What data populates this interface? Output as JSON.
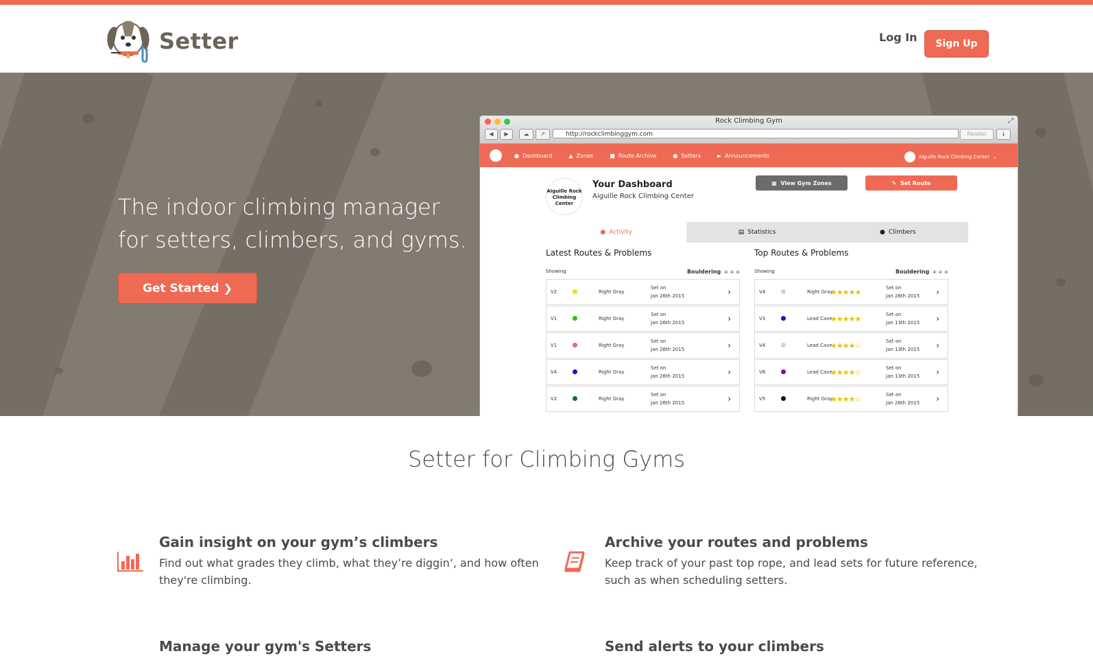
{
  "colors": {
    "accent": "#ef6a55",
    "text": "#4a4a4a",
    "hero_bg": "#817b71"
  },
  "header": {
    "brand": "Setter",
    "login_label": "Log In",
    "signup_label": "Sign Up"
  },
  "hero": {
    "title": "The indoor climbing manager for setters, climbers, and gyms.",
    "cta_label": "Get Started"
  },
  "browser": {
    "window_title": "Rock Climbing Gym",
    "url": "http://rockclimbinggym.com",
    "reader_label": "Reader",
    "nav_items": [
      "Dashboard",
      "Zones",
      "Route Archive",
      "Setters",
      "Announcements"
    ],
    "gym_menu": "Aiguille Rock Climbing Center",
    "gym_logo_text": "Aiguille Rock Climbing Center",
    "dashboard_title": "Your Dashboard",
    "dashboard_subtitle": "Aiguille Rock Climbing Center",
    "view_zones_label": "View Gym Zones",
    "set_route_label": "Set Route",
    "tabs": [
      "Activity",
      "Statistics",
      "Climbers"
    ],
    "latest": {
      "title": "Latest Routes & Problems",
      "showing": "Showing",
      "filter": "Bouldering",
      "rows": [
        {
          "grade": "V2",
          "color": "#f4e100",
          "zone": "Right Gray",
          "set_label": "Set on",
          "date": "Jan 26th 2015"
        },
        {
          "grade": "V1",
          "color": "#25c400",
          "zone": "Right Gray",
          "set_label": "Set on",
          "date": "Jan 26th 2015"
        },
        {
          "grade": "V1",
          "color": "#f25ca0",
          "zone": "Right Gray",
          "set_label": "Set on",
          "date": "Jan 26th 2015"
        },
        {
          "grade": "V4",
          "color": "#1414d4",
          "zone": "Right Gray",
          "set_label": "Set on",
          "date": "Jan 26th 2015"
        },
        {
          "grade": "V2",
          "color": "#0f6e1e",
          "zone": "Right Gray",
          "set_label": "Set on",
          "date": "Jan 26th 2015"
        }
      ]
    },
    "top": {
      "title": "Top Routes & Problems",
      "showing": "Showing",
      "filter": "Bouldering",
      "rows": [
        {
          "grade": "V4",
          "color": "#d6d6c0",
          "zone": "Right Gray",
          "stars": "★★★★★",
          "set_label": "Set on",
          "date": "Jan 26th 2015"
        },
        {
          "grade": "V3",
          "color": "#1414d4",
          "zone": "Lead Cave",
          "stars": "★★★★★",
          "set_label": "Set on",
          "date": "Jan 13th 2015"
        },
        {
          "grade": "V4",
          "color": "#d6d6c0",
          "zone": "Lead Cave",
          "stars": "★★★★☆",
          "set_label": "Set on",
          "date": "Jan 13th 2015"
        },
        {
          "grade": "V6",
          "color": "#8a0f8a",
          "zone": "Lead Cave",
          "stars": "★★★★☆",
          "set_label": "Set on",
          "date": "Jan 13th 2015"
        },
        {
          "grade": "V5",
          "color": "#111111",
          "zone": "Right Gray",
          "stars": "★★★★☆",
          "set_label": "Set on",
          "date": "Jan 26th 2015"
        }
      ]
    }
  },
  "features": {
    "section_title": "Setter for Climbing Gyms",
    "items": [
      {
        "icon": "bar-chart-icon",
        "title": "Gain insight on your gym’s climbers",
        "text": "Find out what grades they climb, what they’re diggin’, and how often they're climbing."
      },
      {
        "icon": "book-icon",
        "title": "Archive your routes and problems",
        "text": "Keep track of your past top rope, and lead sets for future reference, such as when scheduling setters."
      },
      {
        "title": "Manage your gym's Setters"
      },
      {
        "title": "Send alerts to your climbers"
      }
    ]
  }
}
